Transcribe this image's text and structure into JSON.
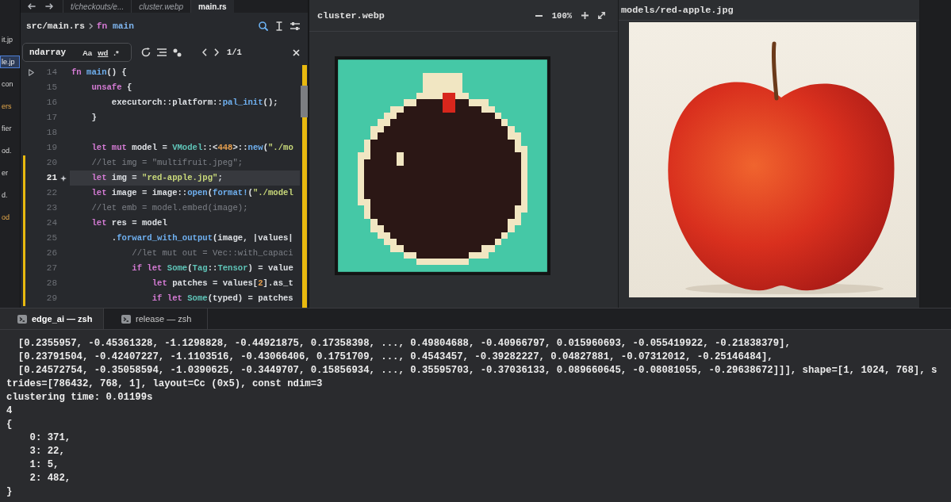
{
  "tabs": [
    {
      "label": "t/checkouts/e...",
      "selected": false,
      "preview": true
    },
    {
      "label": "cluster.webp",
      "selected": false,
      "preview": true
    },
    {
      "label": "main.rs",
      "selected": true,
      "preview": false
    }
  ],
  "project_panel": {
    "items": [
      {
        "label": "it.jp",
        "selected": false,
        "modified": false
      },
      {
        "label": "le.jp",
        "selected": true,
        "modified": false
      },
      {
        "label": "con",
        "selected": false,
        "modified": false
      },
      {
        "label": "ers",
        "selected": false,
        "modified": true
      },
      {
        "label": "fier",
        "selected": false,
        "modified": false
      },
      {
        "label": "od.",
        "selected": false,
        "modified": false
      },
      {
        "label": "er",
        "selected": false,
        "modified": false
      },
      {
        "label": "d.",
        "selected": false,
        "modified": false
      },
      {
        "label": "od",
        "selected": false,
        "modified": true
      }
    ]
  },
  "editor": {
    "breadcrumb": {
      "path": "src/main.rs",
      "symbol_kind": "fn",
      "symbol": "main"
    },
    "find": {
      "value": "ndarray",
      "options": [
        {
          "kind": "case",
          "label": "Aa"
        },
        {
          "kind": "word",
          "label": "wd"
        },
        {
          "kind": "regex",
          "label": ".*"
        }
      ],
      "count": "1/1"
    },
    "lines": [
      {
        "number": "14",
        "current": false,
        "runnable": true,
        "changed": false,
        "tokens": [
          {
            "kind": "keyword",
            "text": "fn "
          },
          {
            "kind": "function",
            "text": "main"
          },
          {
            "kind": "plain",
            "text": "() {"
          }
        ]
      },
      {
        "number": "15",
        "current": false,
        "runnable": false,
        "changed": false,
        "tokens": [
          {
            "kind": "keyword",
            "text": "    unsafe"
          },
          {
            "kind": "plain",
            "text": " {"
          }
        ]
      },
      {
        "number": "16",
        "current": false,
        "runnable": false,
        "changed": false,
        "tokens": [
          {
            "kind": "plain",
            "text": "        executorch::platform::"
          },
          {
            "kind": "function",
            "text": "pal_init"
          },
          {
            "kind": "plain",
            "text": "();"
          }
        ]
      },
      {
        "number": "17",
        "current": false,
        "runnable": false,
        "changed": false,
        "tokens": [
          {
            "kind": "plain",
            "text": "    }"
          }
        ]
      },
      {
        "number": "18",
        "current": false,
        "runnable": false,
        "changed": false
      },
      {
        "number": "19",
        "current": false,
        "runnable": false,
        "changed": false,
        "tokens": [
          {
            "kind": "keyword",
            "text": "    let mut"
          },
          {
            "kind": "plain",
            "text": " model = "
          },
          {
            "kind": "type",
            "text": "VModel"
          },
          {
            "kind": "plain",
            "text": "::<"
          },
          {
            "kind": "number",
            "text": "448"
          },
          {
            "kind": "plain",
            "text": ">::"
          },
          {
            "kind": "function",
            "text": "new"
          },
          {
            "kind": "plain",
            "text": "("
          },
          {
            "kind": "string",
            "text": "\"./mo"
          }
        ]
      },
      {
        "number": "20",
        "current": false,
        "runnable": false,
        "changed": true,
        "tokens": [
          {
            "kind": "comment",
            "text": "    //let img = \"multifruit.jpeg\";"
          }
        ]
      },
      {
        "number": "21",
        "current": true,
        "runnable": false,
        "changed": true,
        "tokens": [
          {
            "kind": "keyword",
            "text": "    let"
          },
          {
            "kind": "plain",
            "text": " img = "
          },
          {
            "kind": "string",
            "text": "\"red-apple.jpg\""
          },
          {
            "kind": "plain",
            "text": ";"
          }
        ]
      },
      {
        "number": "22",
        "current": false,
        "runnable": false,
        "changed": true,
        "tokens": [
          {
            "kind": "keyword",
            "text": "    let"
          },
          {
            "kind": "plain",
            "text": " image = image::"
          },
          {
            "kind": "function",
            "text": "open"
          },
          {
            "kind": "plain",
            "text": "("
          },
          {
            "kind": "function",
            "text": "format!"
          },
          {
            "kind": "plain",
            "text": "("
          },
          {
            "kind": "string",
            "text": "\"./model"
          }
        ]
      },
      {
        "number": "23",
        "current": false,
        "runnable": false,
        "changed": true,
        "tokens": [
          {
            "kind": "comment",
            "text": "    //let emb = model.embed(image);"
          }
        ]
      },
      {
        "number": "24",
        "current": false,
        "runnable": false,
        "changed": true,
        "tokens": [
          {
            "kind": "keyword",
            "text": "    let"
          },
          {
            "kind": "plain",
            "text": " res = model"
          }
        ]
      },
      {
        "number": "25",
        "current": false,
        "runnable": false,
        "changed": true,
        "tokens": [
          {
            "kind": "plain",
            "text": "        ."
          },
          {
            "kind": "function",
            "text": "forward_with_output"
          },
          {
            "kind": "plain",
            "text": "(image, |values|"
          }
        ]
      },
      {
        "number": "26",
        "current": false,
        "runnable": false,
        "changed": true,
        "tokens": [
          {
            "kind": "comment",
            "text": "            //let mut out = Vec::with_capaci"
          }
        ]
      },
      {
        "number": "27",
        "current": false,
        "runnable": false,
        "changed": true,
        "tokens": [
          {
            "kind": "keyword",
            "text": "            if let "
          },
          {
            "kind": "type",
            "text": "Some"
          },
          {
            "kind": "plain",
            "text": "("
          },
          {
            "kind": "type",
            "text": "Tag"
          },
          {
            "kind": "plain",
            "text": "::"
          },
          {
            "kind": "type",
            "text": "Tensor"
          },
          {
            "kind": "plain",
            "text": ") = value"
          }
        ]
      },
      {
        "number": "28",
        "current": false,
        "runnable": false,
        "changed": true,
        "tokens": [
          {
            "kind": "keyword",
            "text": "                let"
          },
          {
            "kind": "plain",
            "text": " patches = values["
          },
          {
            "kind": "number",
            "text": "2"
          },
          {
            "kind": "plain",
            "text": "].as_t"
          }
        ]
      },
      {
        "number": "29",
        "current": false,
        "runnable": false,
        "changed": true,
        "tokens": [
          {
            "kind": "keyword",
            "text": "                if let "
          },
          {
            "kind": "type",
            "text": "Some"
          },
          {
            "kind": "plain",
            "text": "(typed) = patches"
          }
        ]
      }
    ]
  },
  "image_panes": [
    {
      "kind": "pixel_art",
      "title": "cluster.webp",
      "zoom": "100%"
    },
    {
      "kind": "photo",
      "title": "models/red-apple.jpg"
    }
  ],
  "terminal": {
    "tabs": [
      {
        "label": "edge_ai — zsh",
        "selected": true
      },
      {
        "label": "release — zsh",
        "selected": false
      }
    ],
    "lines": [
      "  [0.2355957, -0.45361328, -1.1298828, -0.44921875, 0.17358398, ..., 0.49804688, -0.40966797, 0.015960693, -0.055419922, -0.21838379],",
      "  [0.23791504, -0.42407227, -1.1103516, -0.43066406, 0.1751709, ..., 0.4543457, -0.39282227, 0.04827881, -0.07312012, -0.25146484],",
      "  [0.24572754, -0.35058594, -1.0390625, -0.3449707, 0.15856934, ..., 0.35595703, -0.37036133, 0.089660645, -0.08081055, -0.29638672]]], shape=[1, 1024, 768], s",
      "trides=[786432, 768, 1], layout=Cc (0x5), const ndim=3",
      "clustering time: 0.01199s",
      "4",
      "{",
      "    0: 371,",
      "    3: 22,",
      "    1: 5,",
      "    2: 482,",
      "}"
    ]
  }
}
